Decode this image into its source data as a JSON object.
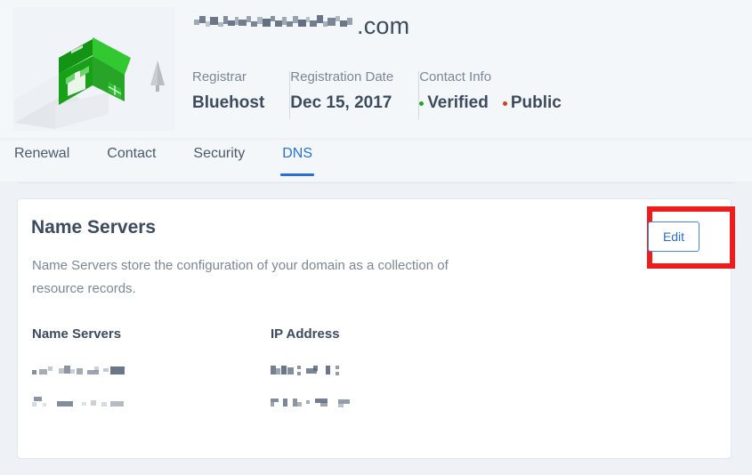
{
  "header": {
    "domain_suffix": ".com",
    "domain_redacted": true,
    "illustration_name": "isometric-green-house",
    "info": [
      {
        "label": "Registrar",
        "value": "Bluehost"
      },
      {
        "label": "Registration Date",
        "value": "Dec 15, 2017"
      }
    ],
    "contact": {
      "label": "Contact Info",
      "statuses": [
        {
          "text": "Verified",
          "color": "#2aa02a"
        },
        {
          "text": "Public",
          "color": "#e03b21"
        }
      ]
    }
  },
  "tabs": [
    {
      "label": "Renewal",
      "active": false
    },
    {
      "label": "Contact",
      "active": false
    },
    {
      "label": "Security",
      "active": false
    },
    {
      "label": "DNS",
      "active": true
    }
  ],
  "card": {
    "title": "Name Servers",
    "description": "Name Servers store the configuration of your domain as a collection of resource records.",
    "edit_label": "Edit",
    "table": {
      "headers": [
        "Name Servers",
        "IP Address"
      ],
      "rows": [
        {
          "name_server": "",
          "ip_address": "",
          "redacted": true
        },
        {
          "name_server": "",
          "ip_address": "",
          "redacted": true
        }
      ]
    }
  },
  "annotation": {
    "type": "highlight-rectangle",
    "target": "edit-button",
    "color": "#ee1d1d"
  },
  "colors": {
    "page_background": "#eef2f6",
    "header_background": "#f4f7fa",
    "card_background": "#ffffff",
    "accent_blue": "#2a6fd6",
    "text_dark": "#3d4b5f",
    "text_muted": "#7b8796"
  }
}
